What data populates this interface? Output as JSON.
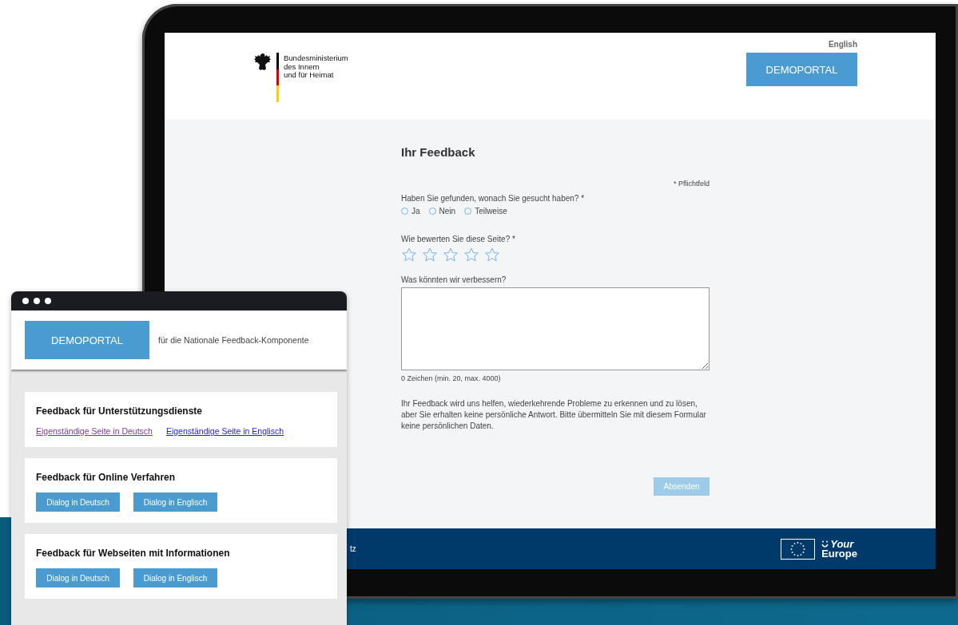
{
  "tablet": {
    "header": {
      "ministry": [
        "Bundesministerium",
        "des Innern",
        "und für Heimat"
      ],
      "language_link": "English",
      "portal_button": "DEMOPORTAL"
    },
    "form": {
      "title": "Ihr Feedback",
      "required_note": "* Pflichtfeld",
      "question": "Haben Sie gefunden, wonach Sie gesucht haben? *",
      "options": [
        {
          "label": "Ja",
          "selected": false
        },
        {
          "label": "Nein",
          "selected": false
        },
        {
          "label": "Teilweise",
          "selected": false
        }
      ],
      "rating_label": "Wie bewerten Sie diese Seite? *",
      "stars": 0,
      "comment_label": "Was könnten wir verbessern?",
      "char_count": "0 Zeichen (min. 20, max. 4000)",
      "info": "Ihr Feedback wird uns helfen, wiederkehrende Probleme zu erkennen und zu lösen, aber Sie erhalten keine persönliche Antwort. Bitte übermitteln Sie mit diesem Formular keine persönlichen Daten.",
      "submit": {
        "label": "Absenden",
        "disabled": true
      }
    },
    "footer": {
      "link": "tz",
      "logo": [
        "Your",
        "Europe"
      ]
    }
  },
  "browser_window": {
    "portal_button": "DEMOPORTAL",
    "subtitle": "für die Nationale Feedback-Komponente",
    "sections": [
      {
        "title": "Feedback für Unterstützungsdienste",
        "kind": "links",
        "items": [
          {
            "label": "Eigenständige Seite in Deutsch",
            "visited": true
          },
          {
            "label": "Eigenständige Seite in Englisch",
            "visited": false
          }
        ]
      },
      {
        "title": "Feedback für Online Verfahren",
        "kind": "buttons",
        "items": [
          {
            "label": "Dialog in Deutsch"
          },
          {
            "label": "Dialog in Englisch"
          }
        ]
      },
      {
        "title": "Feedback für Webseiten mit Informationen",
        "kind": "buttons",
        "items": [
          {
            "label": "Dialog in Deutsch"
          },
          {
            "label": "Dialog in Englisch"
          }
        ]
      }
    ]
  }
}
